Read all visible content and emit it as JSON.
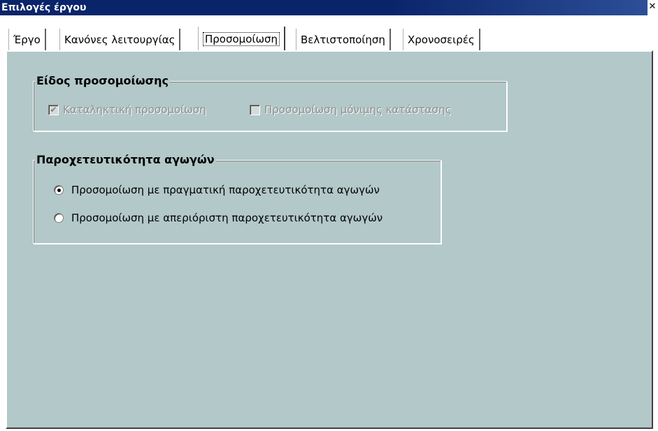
{
  "window": {
    "title": "Επιλογές έργου",
    "close_glyph": "✕"
  },
  "tabs": [
    {
      "label": "Έργο",
      "active": false
    },
    {
      "label": "Κανόνες λειτουργίας",
      "active": false
    },
    {
      "label": "Προσομοίωση",
      "active": true
    },
    {
      "label": "Βελτιστοποίηση",
      "active": false
    },
    {
      "label": "Χρονοσειρές",
      "active": false
    }
  ],
  "simulation_type": {
    "title": "Είδος προσομοίωσης",
    "options": [
      {
        "label": "Καταληκτική προσομοίωση",
        "checked": true,
        "enabled": false
      },
      {
        "label": "Προσομοίωση μόνιμης κατάστασης",
        "checked": false,
        "enabled": false
      }
    ]
  },
  "conduit_capacity": {
    "title": "Παροχετευτικότητα αγωγών",
    "options": [
      {
        "label": "Προσομοίωση με πραγματική παροχετευτικότητα αγωγών",
        "selected": true
      },
      {
        "label": "Προσομοίωση με απεριόριστη παροχετευτικότητα αγωγών",
        "selected": false
      }
    ]
  },
  "colors": {
    "panel_bg": "#b3c8c8",
    "titlebar": "#0a246a"
  }
}
